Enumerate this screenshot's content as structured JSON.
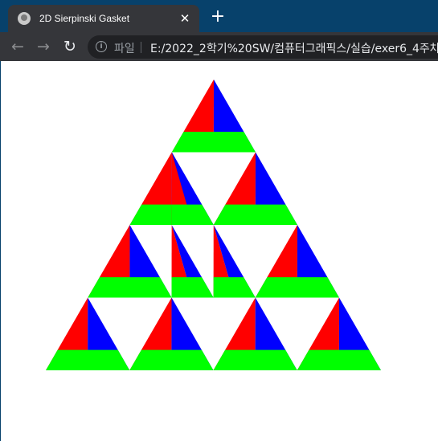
{
  "tab": {
    "title": "2D Sierpinski Gasket",
    "close_icon": "close-icon",
    "favicon": "globe-icon"
  },
  "new_tab_icon": "plus-icon",
  "toolbar": {
    "back_icon": "arrow-left-icon",
    "forward_icon": "arrow-right-icon",
    "reload_icon": "reload-icon"
  },
  "address": {
    "scheme_label": "파일",
    "url": "E:/2022_2학기%20SW/컴퓨터그래픽스/실습/exer6_4주차"
  },
  "colors": {
    "red": "#ff0000",
    "green": "#00ff00",
    "blue": "#0000ff",
    "frame": "#07416b"
  },
  "canvas": {
    "shape": "sierpinski-gasket-colored"
  }
}
